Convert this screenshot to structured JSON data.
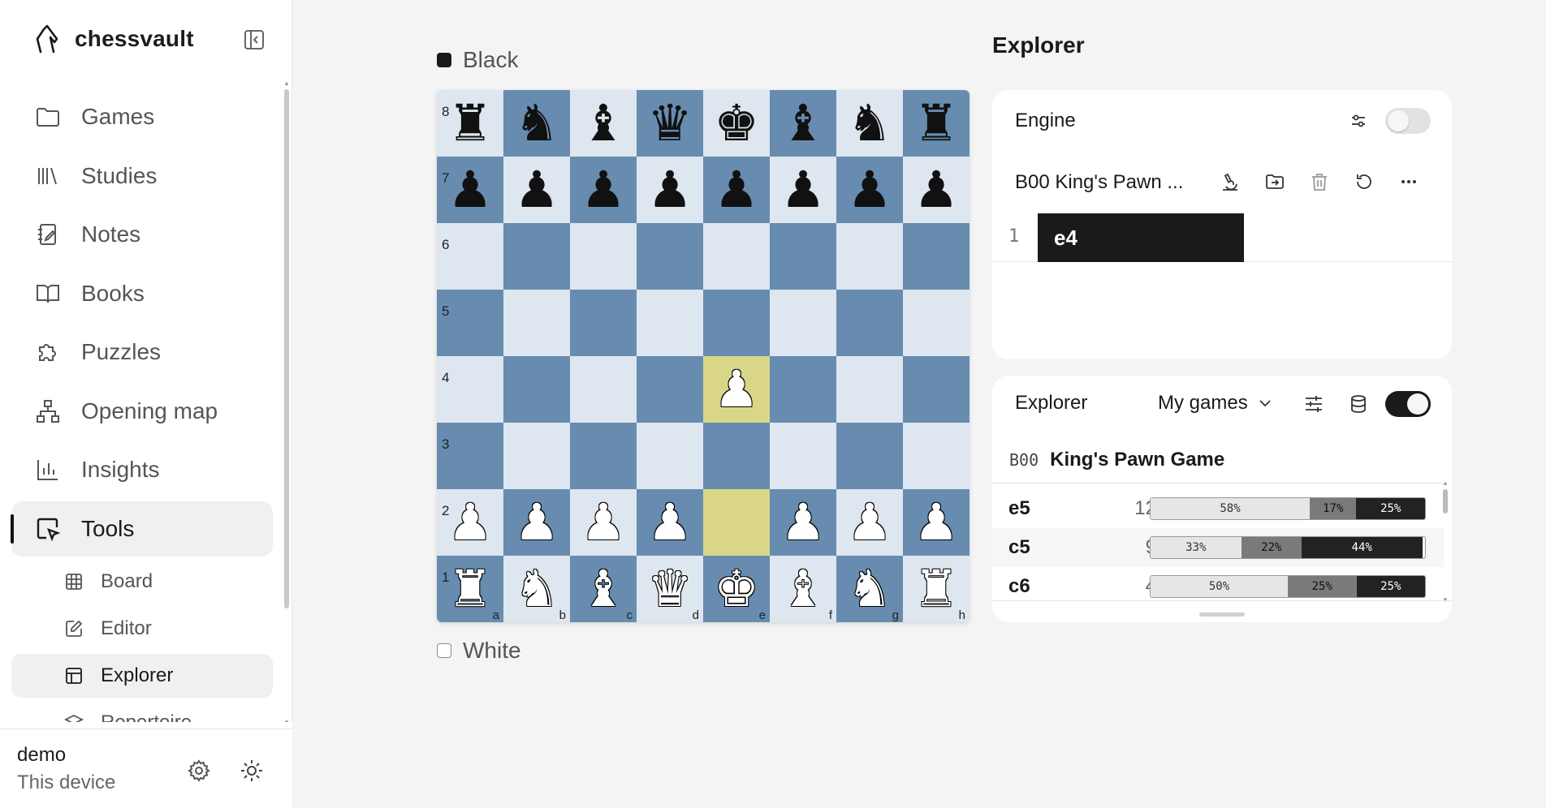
{
  "app": {
    "brand": "chessvault"
  },
  "sidebar": {
    "items": [
      {
        "label": "Games",
        "icon": "folder-icon"
      },
      {
        "label": "Studies",
        "icon": "library-icon"
      },
      {
        "label": "Notes",
        "icon": "notebook-icon"
      },
      {
        "label": "Books",
        "icon": "book-icon"
      },
      {
        "label": "Puzzles",
        "icon": "puzzle-icon"
      },
      {
        "label": "Opening map",
        "icon": "network-icon"
      },
      {
        "label": "Insights",
        "icon": "bar-chart-icon"
      },
      {
        "label": "Tools",
        "icon": "cursor-box-icon"
      }
    ],
    "subitems": [
      {
        "label": "Board",
        "icon": "grid-icon"
      },
      {
        "label": "Editor",
        "icon": "edit-icon"
      },
      {
        "label": "Explorer",
        "icon": "table-icon"
      },
      {
        "label": "Repertoire",
        "icon": "layers-icon"
      }
    ],
    "user": {
      "name": "demo",
      "device": "This device"
    }
  },
  "board": {
    "top_player": "Black",
    "bottom_player": "White",
    "rows": [
      "♜♞♝♛♚♝♞♜",
      "♟♟♟♟♟♟♟♟",
      "        ",
      "        ",
      "    ♟   ",
      "        ",
      "♟♟♟♟ ♟♟♟",
      "♜♞♝♛♚♝♞♜"
    ],
    "colors": [
      "b",
      "b",
      "b",
      "b",
      "b",
      "b",
      "b",
      "b",
      "b",
      "b",
      "b",
      "b",
      "b",
      "b",
      "b",
      "b"
    ],
    "ranks": [
      "8",
      "7",
      "6",
      "5",
      "4",
      "3",
      "2",
      "1"
    ],
    "files": [
      "a",
      "b",
      "c",
      "d",
      "e",
      "f",
      "g",
      "h"
    ],
    "highlight": [
      "e2",
      "e4"
    ],
    "light_color": "#dee6ef",
    "dark_color": "#678cb0",
    "highlight_color": "#d9d787"
  },
  "right": {
    "title": "Explorer",
    "engine": {
      "label": "Engine",
      "enabled": false
    },
    "game": {
      "title": "B00 King's Pawn ...",
      "moves": [
        {
          "num": "1",
          "san": "e4"
        }
      ]
    },
    "explorer": {
      "label": "Explorer",
      "source": "My games",
      "enabled": true,
      "eco": "B00",
      "opening": "King's Pawn Game",
      "moves": [
        {
          "san": "e5",
          "count": "12",
          "white": 58,
          "draw": 17,
          "black": 25
        },
        {
          "san": "c5",
          "count": "9",
          "white": 33,
          "draw": 22,
          "black": 44
        },
        {
          "san": "c6",
          "count": "4",
          "white": 50,
          "draw": 25,
          "black": 25
        }
      ]
    }
  }
}
